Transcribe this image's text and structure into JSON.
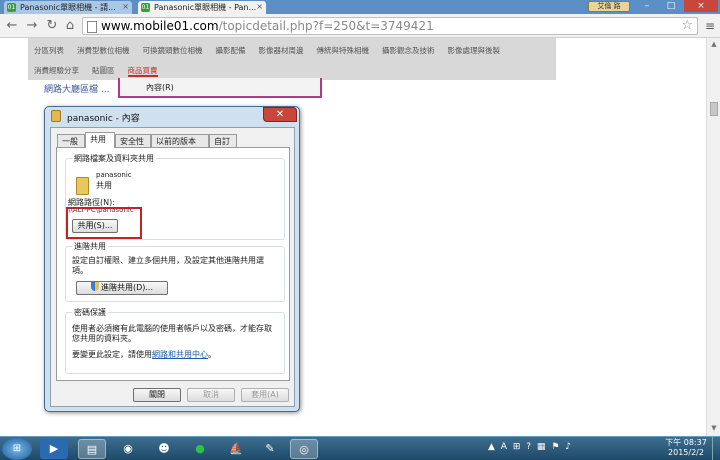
{
  "browser": {
    "tabs": [
      {
        "title": "Panasonic單眼相機 - 請..."
      },
      {
        "title": "Panasonic單眼相機 - Pan..."
      }
    ],
    "user_badge": "艾倫 路",
    "window_controls": {
      "minimize": "–",
      "maximize": "□",
      "close": "×"
    },
    "url_host": "www.mobile01.com",
    "url_path": "/topicdetail.php?f=250&t=3749421"
  },
  "site_nav": {
    "row1": [
      "分區列表",
      "消費型數位相機",
      "可換鏡頭數位相機",
      "攝影配備",
      "影像器材周邊",
      "傳統與特殊相機",
      "攝影觀念及技術",
      "影像處理與後製"
    ],
    "row2": [
      "消費經驗分享",
      "貼圖區",
      "商品買賣"
    ]
  },
  "context_menu": {
    "item": "內容(R)"
  },
  "background": {
    "snippet": "網路大廳區檔 ..."
  },
  "dialog": {
    "title": "panasonic - 內容",
    "tabs": [
      "一般",
      "共用",
      "安全性",
      "以前的版本",
      "自訂"
    ],
    "active_tab": 1,
    "network_group": {
      "legend": "網路檔案及資料夾共用",
      "folder_name": "panasonic",
      "folder_status": "共用",
      "path_label": "網路路徑(N):",
      "path_value": "\\\\ALT-PC\\panasonic",
      "share_button": "共用(S)..."
    },
    "advanced_group": {
      "legend": "進階共用",
      "desc_line1": "設定自訂權限、建立多個共用，及設定其他進階共用選",
      "desc_line2": "項。",
      "button": "進階共用(D)..."
    },
    "password_group": {
      "legend": "密碼保護",
      "desc_line1": "使用者必須擁有此電腦的使用者帳戶以及密碼，才能存取",
      "desc_line2": "您共用的資料夾。",
      "change_prefix": "要變更此設定，請使用",
      "change_link": "網路和共用中心",
      "change_suffix": "。"
    },
    "buttons": {
      "close": "關閉",
      "cancel": "取消",
      "apply": "套用(A)"
    }
  },
  "taskbar": {
    "clock_time": "下午 08:37",
    "clock_date": "2015/2/2",
    "input_indicator": "A"
  }
}
